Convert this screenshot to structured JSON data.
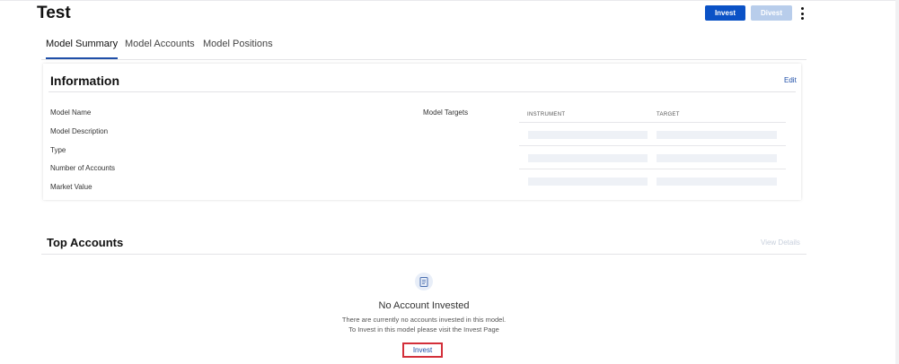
{
  "page": {
    "title": "Test"
  },
  "header": {
    "invest_label": "Invest",
    "divest_label": "Divest"
  },
  "tabs": [
    {
      "label": "Model Summary",
      "active": true
    },
    {
      "label": "Model Accounts",
      "active": false
    },
    {
      "label": "Model Positions",
      "active": false
    }
  ],
  "information": {
    "title": "Information",
    "edit_label": "Edit",
    "fields": [
      "Model Name",
      "Model Description",
      "Type",
      "Number of Accounts",
      "Market Value"
    ],
    "targets_label": "Model Targets",
    "targets_table": {
      "columns": [
        "INSTRUMENT",
        "TARGET"
      ]
    }
  },
  "top_accounts": {
    "title": "Top Accounts",
    "view_details_label": "View Details",
    "empty_state": {
      "icon": "document-icon",
      "title": "No Account Invested",
      "line1": "There are currently no accounts invested in this model.",
      "line2": "To Invest in this model please visit the Invest Page",
      "action_label": "Invest"
    }
  },
  "colors": {
    "primary": "#0b52c6",
    "disabled": "#b8cdeb",
    "link": "#1f4fa8",
    "highlight": "#d32f3a"
  }
}
